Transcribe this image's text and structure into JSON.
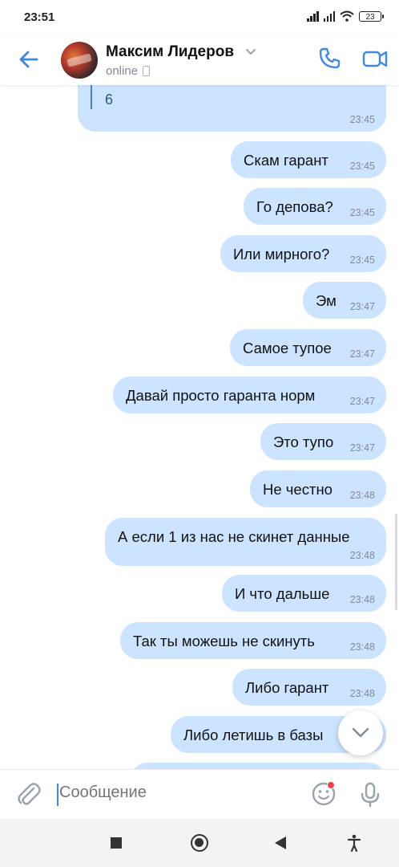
{
  "status_bar": {
    "time": "23:51",
    "battery": "23"
  },
  "header": {
    "contact_name": "Максим Лидеров",
    "status": "online"
  },
  "quoted_message": {
    "text": "6",
    "time": "23:45"
  },
  "messages": [
    {
      "text": "Скам гарант",
      "time": "23:45"
    },
    {
      "text": "Го депова?",
      "time": "23:45"
    },
    {
      "text": "Или мирного?",
      "time": "23:45"
    },
    {
      "text": "Эм",
      "time": "23:47"
    },
    {
      "text": "Самое тупое",
      "time": "23:47"
    },
    {
      "text": "Давай просто гаранта норм",
      "time": "23:47"
    },
    {
      "text": "Это тупо",
      "time": "23:47"
    },
    {
      "text": "Не честно",
      "time": "23:48"
    },
    {
      "text": "А если 1 из нас не скинет данные",
      "time": "23:48"
    },
    {
      "text": "И что дальше",
      "time": "23:48"
    },
    {
      "text": "Так ты можешь не скинуть",
      "time": "23:48"
    },
    {
      "text": "Либо гарант",
      "time": "23:48"
    },
    {
      "text": "Либо летишь в базы",
      "time": ""
    }
  ],
  "composer": {
    "placeholder": "Сообщение"
  },
  "colors": {
    "accent": "#3f8ae0",
    "bubble_out": "#cce4ff",
    "secondary_text": "#818c99"
  },
  "icons": [
    "back-arrow-icon",
    "chevron-down-icon",
    "phone-icon",
    "video-camera-icon",
    "attach-paperclip-icon",
    "emoji-smile-icon",
    "microphone-icon",
    "scroll-down-chevron-icon"
  ]
}
